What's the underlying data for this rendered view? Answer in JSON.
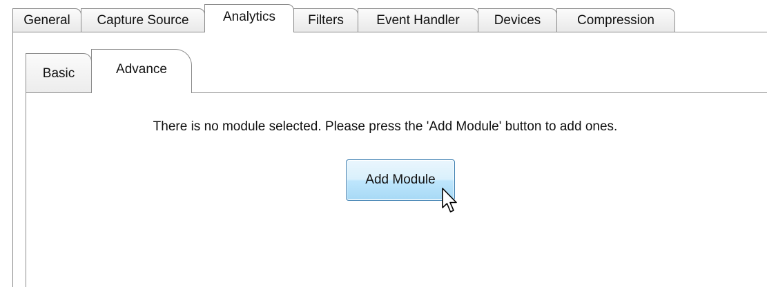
{
  "top_tabs": [
    {
      "label": "General",
      "selected": false
    },
    {
      "label": "Capture Source",
      "selected": false
    },
    {
      "label": "Analytics",
      "selected": true
    },
    {
      "label": "Filters",
      "selected": false
    },
    {
      "label": "Event Handler",
      "selected": false
    },
    {
      "label": "Devices",
      "selected": false
    },
    {
      "label": "Compression",
      "selected": false
    }
  ],
  "inner_tabs": [
    {
      "label": "Basic",
      "selected": false
    },
    {
      "label": "Advance",
      "selected": true
    }
  ],
  "content": {
    "message": "There is no module selected. Please press the 'Add Module' button to add ones.",
    "add_module_button": "Add Module"
  },
  "colors": {
    "tab_border": "#8a8a8a",
    "button_border": "#3c7fb1",
    "button_fill": "#bee6fd"
  },
  "icons": {
    "cursor": "mouse-pointer-icon"
  }
}
